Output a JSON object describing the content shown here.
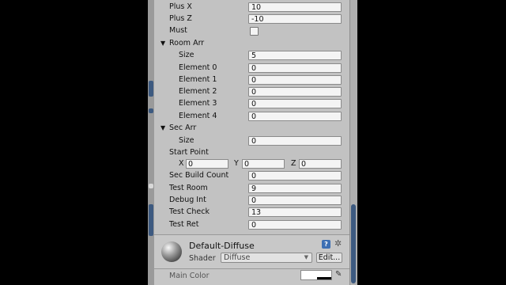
{
  "fields": [
    {
      "label": "Plus X",
      "value": "10"
    },
    {
      "label": "Plus Z",
      "value": "-10"
    }
  ],
  "must_label": "Must",
  "room_arr": {
    "label": "Room Arr",
    "size_label": "Size",
    "size_value": "5",
    "elements": [
      {
        "label": "Element 0",
        "value": "0"
      },
      {
        "label": "Element 1",
        "value": "0"
      },
      {
        "label": "Element 2",
        "value": "0"
      },
      {
        "label": "Element 3",
        "value": "0"
      },
      {
        "label": "Element 4",
        "value": "0"
      }
    ]
  },
  "sec_arr": {
    "label": "Sec Arr",
    "size_label": "Size",
    "size_value": "0"
  },
  "start_point": {
    "label": "Start Point",
    "x_label": "X",
    "x": "0",
    "y_label": "Y",
    "y": "0",
    "z_label": "Z",
    "z": "0"
  },
  "bottom_fields": [
    {
      "label": "Sec Build Count",
      "value": "0"
    },
    {
      "label": "Test Room",
      "value": "9"
    },
    {
      "label": "Debug Int",
      "value": "0"
    },
    {
      "label": "Test Check",
      "value": "13"
    },
    {
      "label": "Test Ret",
      "value": "0"
    }
  ],
  "material": {
    "name": "Default-Diffuse",
    "shader_label": "Shader",
    "shader_value": "Diffuse",
    "edit_label": "Edit...",
    "help_glyph": "?",
    "main_color_label": "Main Color",
    "main_color": "#ffffff"
  },
  "icons": [
    "foldout-arrow-icon",
    "help-icon",
    "gear-icon",
    "dropdown-arrow-icon",
    "eyedropper-icon"
  ],
  "colors": {
    "panel": "#c2c2c2",
    "accent": "#3d5a80",
    "field": "#f4f4f4"
  }
}
